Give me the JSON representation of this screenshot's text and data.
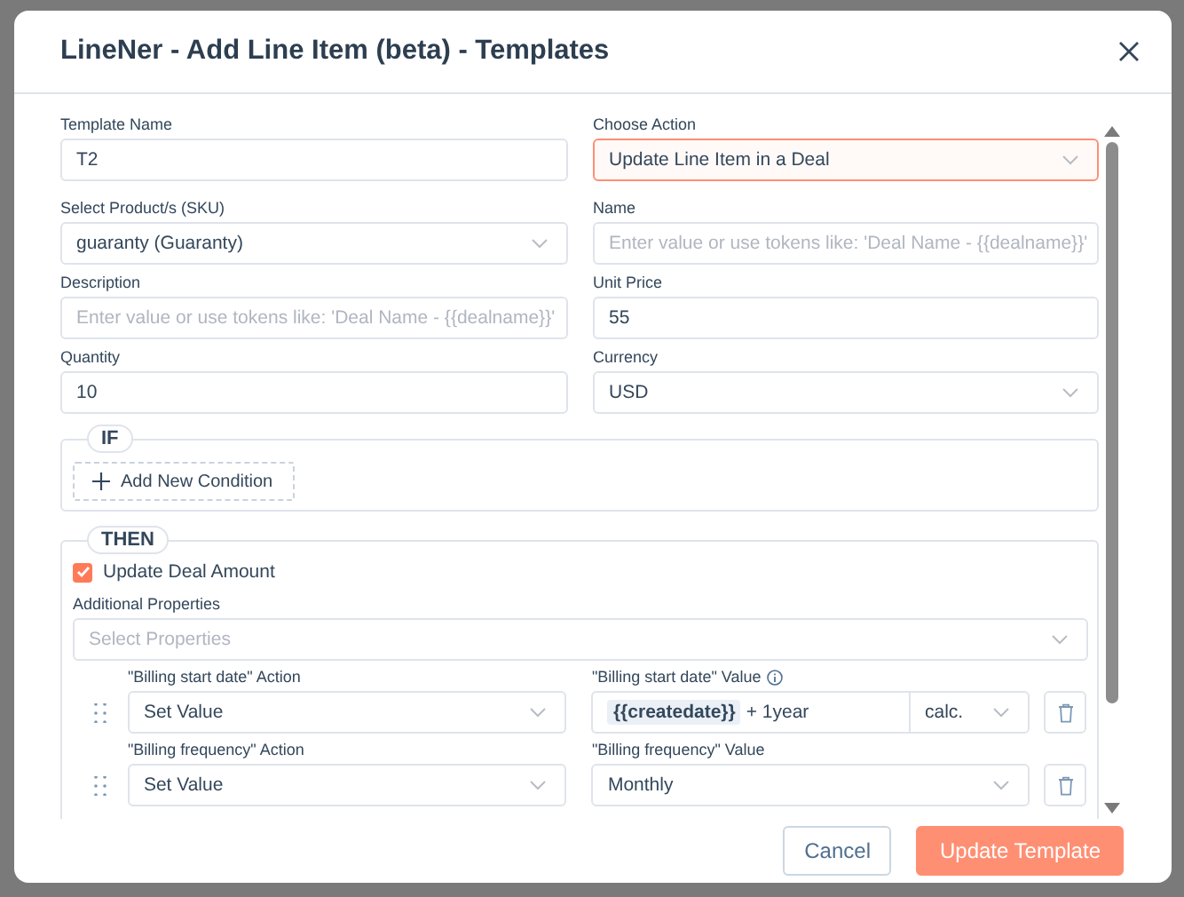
{
  "dialog": {
    "title": "LineNer - Add Line Item (beta) - Templates"
  },
  "fields": [
    {
      "label": "Template Name",
      "kind": "text",
      "value": "T2",
      "focused": false
    },
    {
      "label": "Choose Action",
      "kind": "select",
      "value": "Update Line Item in a Deal",
      "focused": true
    },
    {
      "label": "Select Product/s (SKU)",
      "kind": "select",
      "value": "guaranty (Guaranty)",
      "focused": false
    },
    {
      "label": "Name",
      "kind": "text",
      "placeholder": "Enter value or use tokens like: 'Deal Name - {{dealname}}'",
      "focused": false
    },
    {
      "label": "Description",
      "kind": "text",
      "placeholder": "Enter value or use tokens like: 'Deal Name - {{dealname}}'",
      "focused": false
    },
    {
      "label": "Unit Price",
      "kind": "text",
      "value": "55",
      "focused": false
    },
    {
      "label": "Quantity",
      "kind": "text",
      "value": "10",
      "focused": false
    },
    {
      "label": "Currency",
      "kind": "select",
      "value": "USD",
      "focused": false
    }
  ],
  "if_section": {
    "label": "IF",
    "button": "Add New Condition"
  },
  "then_section": {
    "label": "THEN",
    "checkbox": {
      "label": "Update Deal Amount",
      "checked": true
    },
    "additional_properties": {
      "label": "Additional Properties",
      "placeholder": "Select Properties"
    },
    "property_rows": [
      {
        "action_label": "\"Billing start date\" Action",
        "action_value": "Set Value",
        "value_label": "\"Billing start date\" Value",
        "info": true,
        "kind": "token",
        "token": "{{createdate}}",
        "value": "+ 1year",
        "mode": "calc."
      },
      {
        "action_label": "\"Billing frequency\" Action",
        "action_value": "Set Value",
        "value_label": "\"Billing frequency\" Value",
        "info": false,
        "kind": "select",
        "value": "Monthly"
      }
    ]
  },
  "buttons": [
    {
      "label": "Cancel",
      "kind": "secondary"
    },
    {
      "label": "Update Template",
      "kind": "primary"
    }
  ]
}
